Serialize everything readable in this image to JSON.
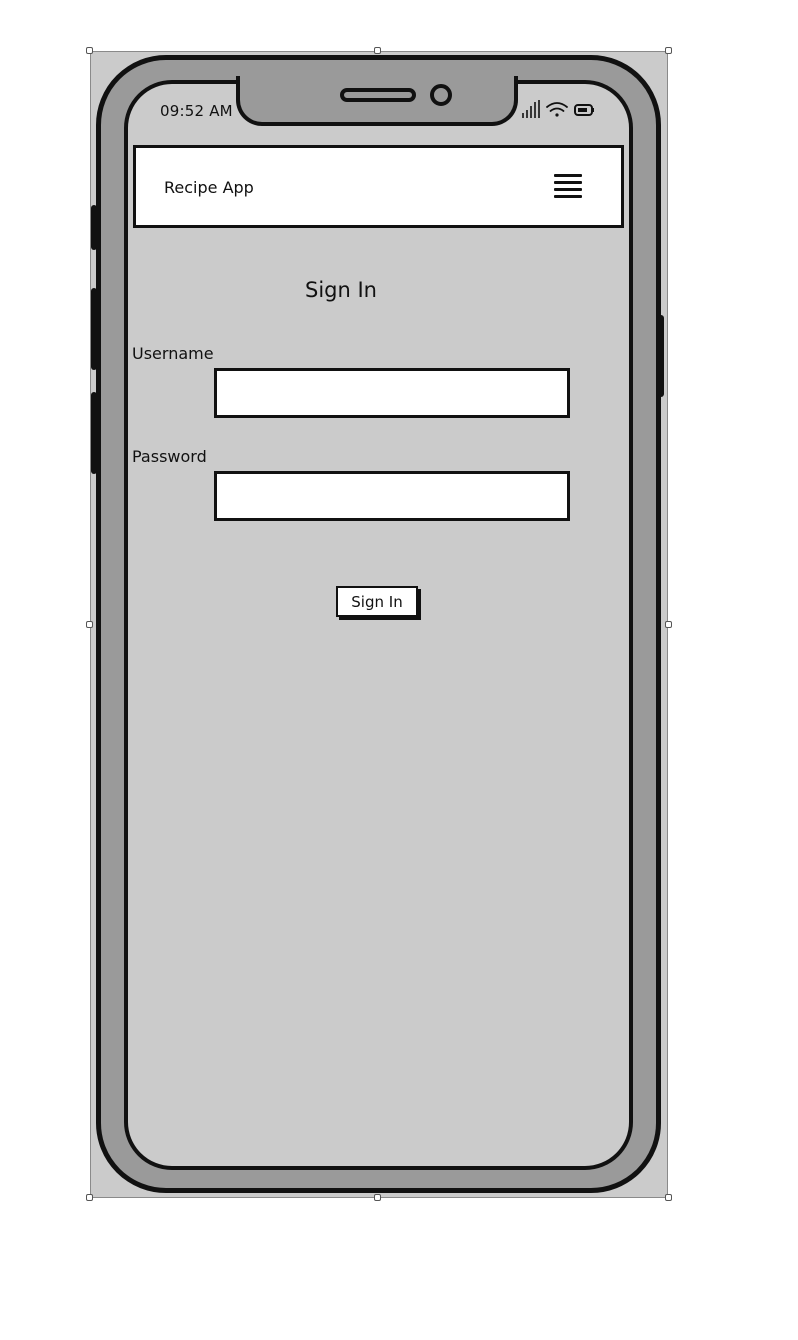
{
  "status_bar": {
    "time": "09:52 AM",
    "icons": [
      "signal-icon",
      "wifi-icon",
      "battery-icon"
    ]
  },
  "navbar": {
    "title": "Recipe App",
    "menu_icon": "hamburger-menu-icon"
  },
  "form": {
    "heading": "Sign In",
    "username_label": "Username",
    "username_value": "",
    "password_label": "Password",
    "password_value": "",
    "submit_label": "Sign In"
  },
  "colors": {
    "screen_background": "#cbcbcb",
    "device_bezel": "#9a9a9a",
    "outline": "#111111",
    "surface": "#ffffff"
  }
}
